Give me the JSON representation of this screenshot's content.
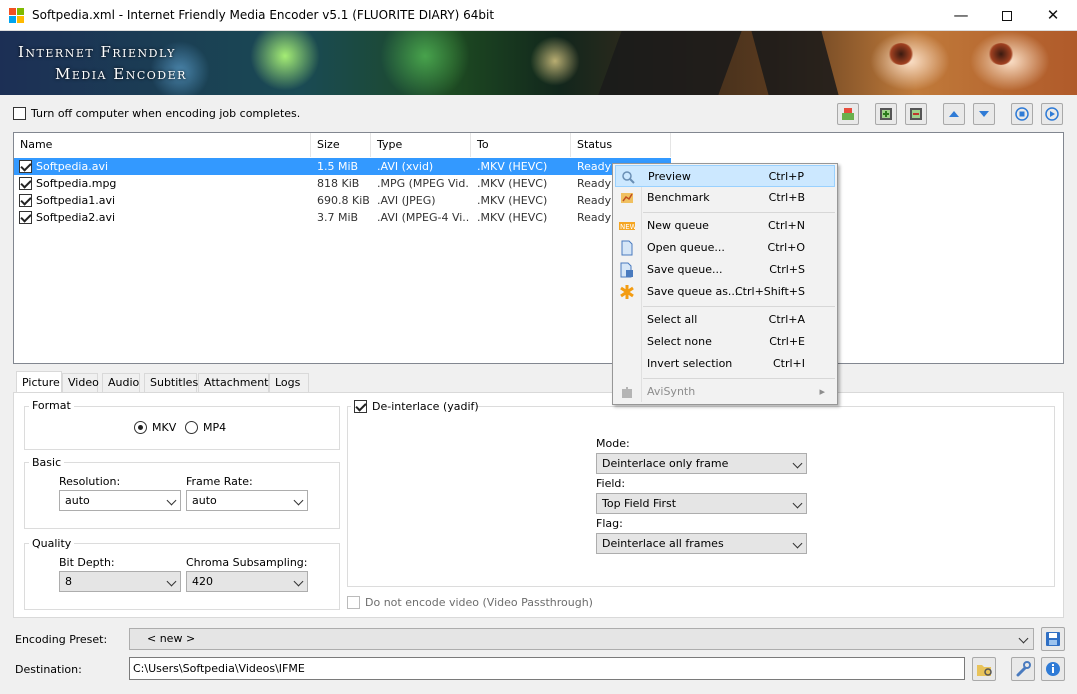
{
  "window": {
    "title": "Softpedia.xml - Internet Friendly Media Encoder v5.1 (FLUORITE DIARY) 64bit",
    "minimize_icon": "minimize-icon",
    "maximize_icon": "maximize-icon",
    "close_icon": "close-icon"
  },
  "banner": {
    "line1": "Internet Friendly",
    "line2": "Media Encoder"
  },
  "options": {
    "shutdown_label": "Turn off computer when encoding job completes.",
    "shutdown_checked": false
  },
  "toolbar": [
    {
      "name": "add-files-icon"
    },
    {
      "name": "add-video-icon"
    },
    {
      "name": "remove-video-icon"
    },
    {
      "name": "move-up-icon"
    },
    {
      "name": "move-down-icon"
    },
    {
      "name": "stop-icon"
    },
    {
      "name": "start-icon"
    }
  ],
  "filelist": {
    "columns": [
      "Name",
      "Size",
      "Type",
      "To",
      "Status"
    ],
    "rows": [
      {
        "name": "Softpedia.avi",
        "size": "1.5 MiB",
        "type": ".AVI (xvid)",
        "to": ".MKV (HEVC)",
        "status": "Ready",
        "checked": true,
        "selected": true
      },
      {
        "name": "Softpedia.mpg",
        "size": "818 KiB",
        "type": ".MPG (MPEG Vid...",
        "to": ".MKV (HEVC)",
        "status": "Ready",
        "checked": true,
        "selected": false
      },
      {
        "name": "Softpedia1.avi",
        "size": "690.8 KiB",
        "type": ".AVI (JPEG)",
        "to": ".MKV (HEVC)",
        "status": "Ready",
        "checked": true,
        "selected": false
      },
      {
        "name": "Softpedia2.avi",
        "size": "3.7 MiB",
        "type": ".AVI (MPEG-4 Vi...",
        "to": ".MKV (HEVC)",
        "status": "Ready",
        "checked": true,
        "selected": false
      }
    ]
  },
  "context_menu": {
    "items": [
      {
        "label": "Preview",
        "shortcut": "Ctrl+P",
        "icon": "magnifier-icon"
      },
      {
        "label": "Benchmark",
        "shortcut": "Ctrl+B",
        "icon": "benchmark-icon"
      },
      {
        "label": "New queue",
        "shortcut": "Ctrl+N",
        "icon": "new-icon"
      },
      {
        "label": "Open queue...",
        "shortcut": "Ctrl+O",
        "icon": "open-document-icon"
      },
      {
        "label": "Save queue...",
        "shortcut": "Ctrl+S",
        "icon": "save-document-icon"
      },
      {
        "label": "Save queue as...",
        "shortcut": "Ctrl+Shift+S",
        "icon": "asterisk-icon"
      },
      {
        "label": "Select all",
        "shortcut": "Ctrl+A"
      },
      {
        "label": "Select none",
        "shortcut": "Ctrl+E"
      },
      {
        "label": "Invert selection",
        "shortcut": "Ctrl+I"
      },
      {
        "label": "AviSynth",
        "shortcut": "",
        "icon": "puzzle-icon"
      }
    ]
  },
  "tabs": [
    "Picture",
    "Video",
    "Audio",
    "Subtitles",
    "Attachments",
    "Logs"
  ],
  "picture": {
    "format_title": "Format",
    "format_options": [
      "MKV",
      "MP4"
    ],
    "format_selected": "MKV",
    "basic_title": "Basic",
    "resolution_label": "Resolution:",
    "resolution_value": "auto",
    "framerate_label": "Frame Rate:",
    "framerate_value": "auto",
    "quality_title": "Quality",
    "bitdepth_label": "Bit Depth:",
    "bitdepth_value": "8",
    "chroma_label": "Chroma Subsampling:",
    "chroma_value": "420",
    "deinterlace_label": "De-interlace (yadif)",
    "deinterlace_checked": true,
    "mode_label": "Mode:",
    "mode_value": "Deinterlace only frame",
    "field_label": "Field:",
    "field_value": "Top Field First",
    "flag_label": "Flag:",
    "flag_value": "Deinterlace all frames",
    "passthrough_label": "Do not encode video (Video Passthrough)"
  },
  "bottom": {
    "preset_label": "Encoding Preset:",
    "preset_value": "< new >",
    "destination_label": "Destination:",
    "destination_value": "C:\\Users\\Softpedia\\Videos\\IFME"
  },
  "colors": {
    "selection": "#3399ff",
    "menu_highlight": "#cce8ff"
  }
}
